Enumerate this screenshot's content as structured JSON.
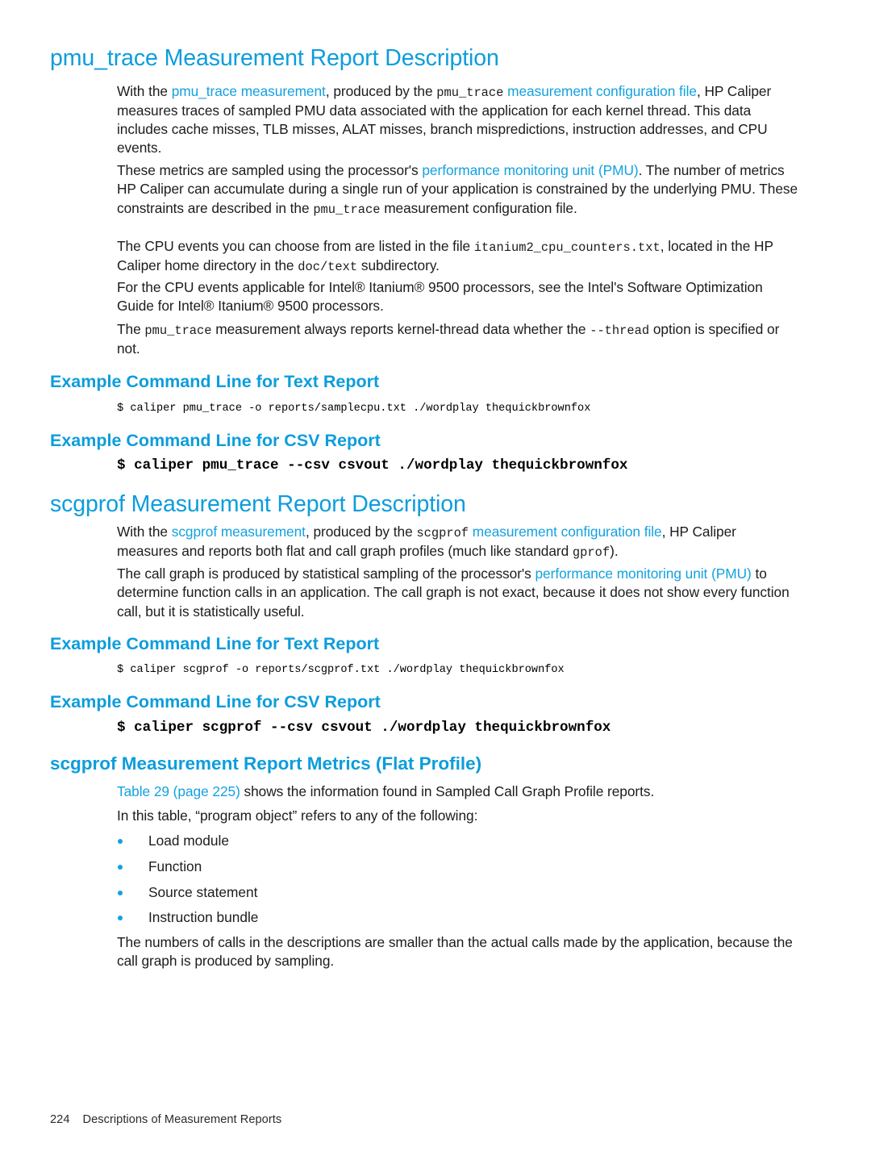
{
  "theme": {
    "accent": "#0c9ddc",
    "link": "#12a1e0",
    "text": "#1c1c1c",
    "background": "#ffffff"
  },
  "sections": {
    "pmu_trace": {
      "heading": "pmu_trace Measurement Report Description",
      "p1": {
        "a": "With the ",
        "link1": "pmu_trace measurement",
        "b": ", produced by the ",
        "mono1": "pmu_trace",
        "link2": " measurement configuration file",
        "c": ", HP Caliper measures traces of sampled PMU data associated with the application for each kernel thread. This data includes cache misses, TLB misses, ALAT misses, branch mispredictions, instruction addresses, and CPU events."
      },
      "p2": {
        "a": "These metrics are sampled using the processor's ",
        "link1": "performance monitoring unit (PMU)",
        "b": ". The number of metrics HP Caliper can accumulate during a single run of your application is constrained by the underlying PMU. These constraints are described in the ",
        "mono1": "pmu_trace",
        "c": " measurement configuration file."
      },
      "p3": {
        "a": "The CPU events you can choose from are listed in the file ",
        "mono1": "itanium2_cpu_counters.txt",
        "b": ", located in the HP Caliper home directory in the ",
        "mono2": "doc/text",
        "c": " subdirectory."
      },
      "p4": {
        "a": "For the CPU events applicable for Intel® Itanium® 9500 processors, see the Intel's Software Optimization Guide for Intel® Itanium® 9500 processors."
      },
      "p5": {
        "a": "The ",
        "mono1": "pmu_trace",
        "b": " measurement always reports kernel-thread data whether the ",
        "mono2": "--thread",
        "c": " option is specified or not."
      },
      "text_report_heading": "Example Command Line for Text Report",
      "text_report_code": "$ caliper pmu_trace -o reports/samplecpu.txt ./wordplay thequickbrownfox",
      "csv_report_heading": "Example Command Line for CSV Report",
      "csv_report_code": "$ caliper pmu_trace --csv csvout ./wordplay thequickbrownfox"
    },
    "scgprof": {
      "heading": "scgprof Measurement Report Description",
      "p1": {
        "a": "With the ",
        "link1": "scgprof measurement",
        "b": ", produced by the ",
        "mono1": "scgprof",
        "link2": " measurement configuration file",
        "c": ", HP Caliper measures and reports both flat and call graph profiles (much like standard ",
        "mono2": "gprof",
        "d": ")."
      },
      "p2": {
        "a": "The call graph is produced by statistical sampling of the processor's ",
        "link1": "performance monitoring unit (PMU)",
        "b": " to determine function calls in an application. The call graph is not exact, because it does not show every function call, but it is statistically useful."
      },
      "text_report_heading": "Example Command Line for Text Report",
      "text_report_code": "$ caliper scgprof -o reports/scgprof.txt ./wordplay thequickbrownfox",
      "csv_report_heading": "Example Command Line for CSV Report",
      "csv_report_code": "$ caliper scgprof --csv csvout ./wordplay thequickbrownfox"
    },
    "flat_profile": {
      "heading": "scgprof Measurement Report Metrics (Flat Profile)",
      "p1": {
        "link1": "Table 29 (page 225)",
        "a": " shows the information found in Sampled Call Graph Profile reports."
      },
      "p2": {
        "a": "In this table, “program object” refers to any of the following:"
      },
      "bullets": [
        "Load module",
        "Function",
        "Source statement",
        "Instruction bundle"
      ],
      "p3": {
        "a": "The numbers of calls in the descriptions are smaller than the actual calls made by the application, because the call graph is produced by sampling."
      }
    }
  },
  "footer": {
    "page_number": "224",
    "label": "Descriptions of Measurement Reports"
  }
}
